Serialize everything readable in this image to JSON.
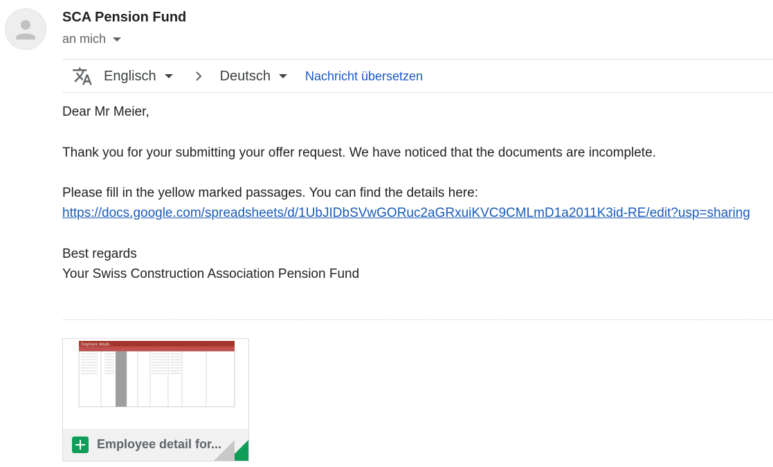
{
  "header": {
    "sender_name": "SCA Pension Fund",
    "recipient_label": "an mich"
  },
  "translate": {
    "source_lang": "Englisch",
    "target_lang": "Deutsch",
    "action_label": "Nachricht übersetzen"
  },
  "message": {
    "greeting": "Dear Mr Meier,",
    "paragraph1": "Thank you for your submitting your offer request. We have noticed that the documents are incomplete.",
    "paragraph2": "Please fill in the yellow marked passages. You can find the details here:",
    "link": "https://docs.google.com/spreadsheets/d/1UbJIDbSVwGORuc2aGRxuiKVC9CMLmD1a2011K3id-RE/edit?usp=sharing",
    "closing": "Best regards",
    "signature": "Your Swiss Construction Association Pension Fund"
  },
  "attachment": {
    "name": "Employee detail for...",
    "type_icon": "google-sheets-icon",
    "thumbnail_title": "Employee details"
  },
  "colors": {
    "link": "#1a5bb8",
    "sheets_green": "#0f9d58",
    "thumbnail_header": "#a3352b"
  }
}
